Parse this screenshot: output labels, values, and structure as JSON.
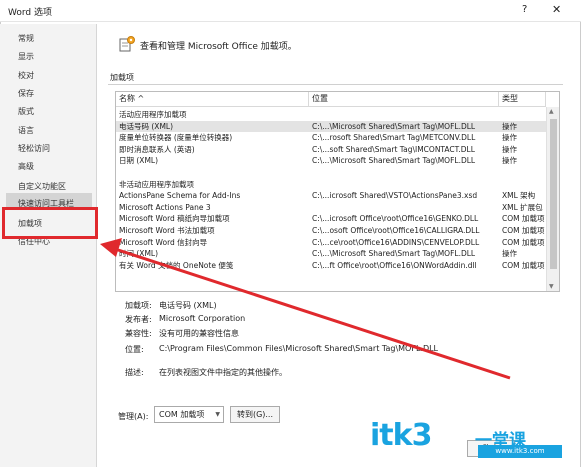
{
  "window": {
    "title": "Word 选项",
    "help_glyph": "?",
    "close_glyph": "✕"
  },
  "sidebar": {
    "items": [
      {
        "label": "常规"
      },
      {
        "label": "显示"
      },
      {
        "label": "校对"
      },
      {
        "label": "保存"
      },
      {
        "label": "版式"
      },
      {
        "label": "语言"
      },
      {
        "label": "轻松访问"
      },
      {
        "label": "高级"
      },
      {
        "label": "自定义功能区"
      },
      {
        "label": "快速访问工具栏"
      },
      {
        "label": "加载项"
      },
      {
        "label": "信任中心"
      }
    ],
    "selected": "加载项"
  },
  "header": {
    "text": "查看和管理 Microsoft Office 加载项。"
  },
  "section": {
    "label": "加载项"
  },
  "table": {
    "columns": [
      "名称 ^",
      "位置",
      "类型"
    ],
    "rows": [
      {
        "name": "活动应用程序加载项",
        "location": "",
        "type": "",
        "group": true
      },
      {
        "name": "电话号码 (XML)",
        "location": "C:\\...\\Microsoft Shared\\Smart Tag\\MOFL.DLL",
        "type": "操作",
        "selected": true
      },
      {
        "name": "度量单位转换器 (度量单位转换器)",
        "location": "C:\\...rosoft Shared\\Smart Tag\\METCONV.DLL",
        "type": "操作"
      },
      {
        "name": "即时消息联系人 (英语)",
        "location": "C:\\...soft Shared\\Smart Tag\\IMCONTACT.DLL",
        "type": "操作"
      },
      {
        "name": "日期 (XML)",
        "location": "C:\\...\\Microsoft Shared\\Smart Tag\\MOFL.DLL",
        "type": "操作"
      },
      {
        "name": "",
        "location": "",
        "type": "",
        "spacer": true
      },
      {
        "name": "非活动应用程序加载项",
        "location": "",
        "type": "",
        "group": true
      },
      {
        "name": "ActionsPane Schema for Add-Ins",
        "location": "C:\\...icrosoft Shared\\VSTO\\ActionsPane3.xsd",
        "type": "XML 架构"
      },
      {
        "name": "Microsoft Actions Pane 3",
        "location": "",
        "type": "XML 扩展包"
      },
      {
        "name": "Microsoft Word 稿纸向导加载项",
        "location": "C:\\...icrosoft Office\\root\\Office16\\GENKO.DLL",
        "type": "COM 加载项"
      },
      {
        "name": "Microsoft Word 书法加载项",
        "location": "C:\\...osoft Office\\root\\Office16\\CALLIGRA.DLL",
        "type": "COM 加载项"
      },
      {
        "name": "Microsoft Word 信封向导",
        "location": "C:\\...ce\\root\\Office16\\ADDINS\\CENVELOP.DLL",
        "type": "COM 加载项"
      },
      {
        "name": "时间 (XML)",
        "location": "C:\\...\\Microsoft Shared\\Smart Tag\\MOFL.DLL",
        "type": "操作"
      },
      {
        "name": "有关 Word 文档的 OneNote 便笺",
        "location": "C:\\...ft Office\\root\\Office16\\ONWordAddin.dll",
        "type": "COM 加载项"
      }
    ]
  },
  "details": {
    "addin_label": "加载项:",
    "addin_value": "电话号码 (XML)",
    "publisher_label": "发布者:",
    "publisher_value": "Microsoft Corporation",
    "compat_label": "兼容性:",
    "compat_value": "没有可用的兼容性信息",
    "location_label": "位置:",
    "location_value": "C:\\Program Files\\Common Files\\Microsoft Shared\\Smart Tag\\MOFL.DLL",
    "desc_label": "描述:",
    "desc_value": "在列表视图文件中指定的其他操作。"
  },
  "manage": {
    "label": "管理(A):",
    "selected": "COM 加载项",
    "go_label": "转到(G)..."
  },
  "footer": {
    "ok_label": "确定"
  },
  "watermark": {
    "text": "itk3",
    "cn": "一堂课",
    "sub": "www.itk3.com"
  },
  "colors": {
    "highlight_box": "#e0292d",
    "watermark": "#1aa3e0"
  }
}
